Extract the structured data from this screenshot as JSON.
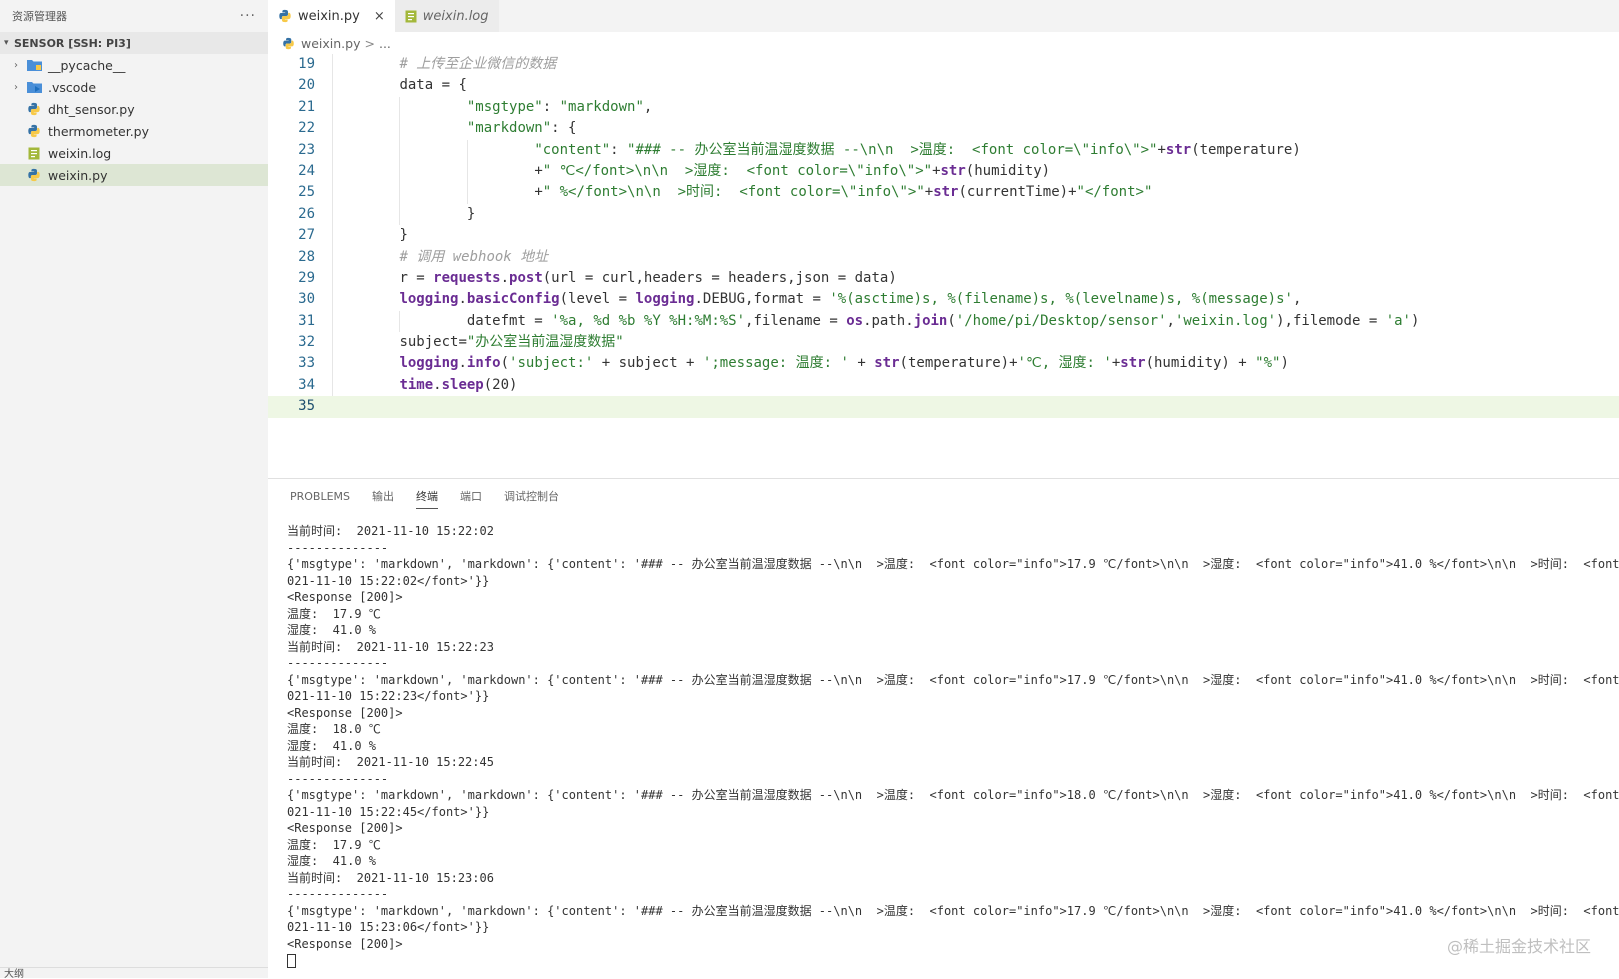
{
  "sidebar": {
    "title": "资源管理器",
    "more": "···",
    "section": "SENSOR [SSH: PI3]",
    "items": [
      {
        "label": "__pycache__",
        "icon": "folder-icon",
        "kind": "folder"
      },
      {
        "label": ".vscode",
        "icon": "vscode-folder-icon",
        "kind": "folder"
      },
      {
        "label": "dht_sensor.py",
        "icon": "python-file-icon",
        "kind": "file"
      },
      {
        "label": "thermometer.py",
        "icon": "python-file-icon",
        "kind": "file"
      },
      {
        "label": "weixin.log",
        "icon": "log-file-icon",
        "kind": "file"
      },
      {
        "label": "weixin.py",
        "icon": "python-file-icon",
        "kind": "file",
        "selected": true
      }
    ],
    "footer": "大纲"
  },
  "tabs": [
    {
      "label": "weixin.py",
      "close": "×"
    },
    {
      "label": "weixin.log"
    }
  ],
  "breadcrumb": {
    "file": "weixin.py",
    "sep": ">",
    "rest": "..."
  },
  "code_lines": [
    {
      "n": "19",
      "indent": 8,
      "html": "<span class=\"cm\"># 上传至企业微信的数据</span>"
    },
    {
      "n": "20",
      "indent": 8,
      "html": "data = {"
    },
    {
      "n": "21",
      "indent": 16,
      "html": "<span class=\"str\">\"msgtype\"</span>: <span class=\"str\">\"markdown\"</span>,"
    },
    {
      "n": "22",
      "indent": 16,
      "html": "<span class=\"str\">\"markdown\"</span>: {"
    },
    {
      "n": "23",
      "indent": 24,
      "html": "<span class=\"str\">\"content\"</span>: <span class=\"str\">\"### -- 办公室当前温湿度数据 --\\n\\n  &gt;温度:  &lt;font color=\\\"info\\\"&gt;\"</span>+<span class=\"kw\">str</span>(temperature)"
    },
    {
      "n": "24",
      "indent": 24,
      "html": "+<span class=\"str\">\" ℃&lt;/font&gt;\\n\\n  &gt;湿度:  &lt;font color=\\\"info\\\"&gt;\"</span>+<span class=\"kw\">str</span>(humidity)"
    },
    {
      "n": "25",
      "indent": 24,
      "html": "+<span class=\"str\">\" %&lt;/font&gt;\\n\\n  &gt;时间:  &lt;font color=\\\"info\\\"&gt;\"</span>+<span class=\"kw\">str</span>(currentTime)+<span class=\"str\">\"&lt;/font&gt;\"</span>"
    },
    {
      "n": "26",
      "indent": 16,
      "html": "}"
    },
    {
      "n": "27",
      "indent": 8,
      "html": "}"
    },
    {
      "n": "28",
      "indent": 8,
      "html": "<span class=\"cm\"># 调用 webhook 地址</span>"
    },
    {
      "n": "29",
      "indent": 8,
      "html": "r = <span class=\"kw\">requests</span>.<span class=\"kw\">post</span>(url = curl,headers = headers,json = data)"
    },
    {
      "n": "30",
      "indent": 8,
      "html": "<span class=\"kw\">logging</span>.<span class=\"kw\">basicConfig</span>(level = <span class=\"kw\">logging</span>.DEBUG,format = <span class=\"str\">'%(asctime)s, %(filename)s, %(levelname)s, %(message)s'</span>,"
    },
    {
      "n": "31",
      "indent": 16,
      "html": "datefmt = <span class=\"str\">'%a, %d %b %Y %H:%M:%S'</span>,filename = <span class=\"kw\">os</span>.path.<span class=\"kw\">join</span>(<span class=\"str\">'/home/pi/Desktop/sensor'</span>,<span class=\"str\">'weixin.log'</span>),filemode = <span class=\"str\">'a'</span>)"
    },
    {
      "n": "32",
      "indent": 8,
      "html": "subject=<span class=\"str\">\"办公室当前温湿度数据\"</span>"
    },
    {
      "n": "33",
      "indent": 8,
      "html": "<span class=\"kw\">logging</span>.<span class=\"kw\">info</span>(<span class=\"str\">'subject:'</span> + subject + <span class=\"str\">';message: 温度: '</span> + <span class=\"kw\">str</span>(temperature)+<span class=\"str\">'℃, 湿度: '</span>+<span class=\"kw\">str</span>(humidity) + <span class=\"str\">\"%\"</span>)"
    },
    {
      "n": "34",
      "indent": 8,
      "html": "<span class=\"kw\">time</span>.<span class=\"kw\">sleep</span>(20)"
    },
    {
      "n": "35",
      "indent": 0,
      "html": "",
      "current": true
    }
  ],
  "panel": {
    "tabs": [
      "PROBLEMS",
      "输出",
      "终端",
      "端口",
      "调试控制台"
    ],
    "active_tab": 2,
    "terminal_lines": [
      "当前时间:  2021-11-10 15:22:02",
      "--------------",
      "{'msgtype': 'markdown', 'markdown': {'content': '### -- 办公室当前温湿度数据 --\\n\\n  >温度:  <font color=\"info\">17.9 ℃/font>\\n\\n  >湿度:  <font color=\"info\">41.0 %</font>\\n\\n  >时间:  <font",
      "021-11-10 15:22:02</font>'}}",
      "<Response [200]>",
      "温度:  17.9 ℃",
      "湿度:  41.0 %",
      "当前时间:  2021-11-10 15:22:23",
      "--------------",
      "{'msgtype': 'markdown', 'markdown': {'content': '### -- 办公室当前温湿度数据 --\\n\\n  >温度:  <font color=\"info\">17.9 ℃/font>\\n\\n  >湿度:  <font color=\"info\">41.0 %</font>\\n\\n  >时间:  <font",
      "021-11-10 15:22:23</font>'}}",
      "<Response [200]>",
      "温度:  18.0 ℃",
      "湿度:  41.0 %",
      "当前时间:  2021-11-10 15:22:45",
      "--------------",
      "{'msgtype': 'markdown', 'markdown': {'content': '### -- 办公室当前温湿度数据 --\\n\\n  >温度:  <font color=\"info\">18.0 ℃/font>\\n\\n  >湿度:  <font color=\"info\">41.0 %</font>\\n\\n  >时间:  <font",
      "021-11-10 15:22:45</font>'}}",
      "<Response [200]>",
      "温度:  17.9 ℃",
      "湿度:  41.0 %",
      "当前时间:  2021-11-10 15:23:06",
      "--------------",
      "{'msgtype': 'markdown', 'markdown': {'content': '### -- 办公室当前温湿度数据 --\\n\\n  >温度:  <font color=\"info\">17.9 ℃/font>\\n\\n  >湿度:  <font color=\"info\">41.0 %</font>\\n\\n  >时间:  <font",
      "021-11-10 15:23:06</font>'}}",
      "<Response [200]>"
    ]
  },
  "watermark": "@稀土掘金技术社区",
  "colors": {
    "python_blue": "#3572A5",
    "python_yellow": "#f7c948",
    "log_green": "#a3b83b",
    "folder_blue": "#4a8fd8"
  }
}
